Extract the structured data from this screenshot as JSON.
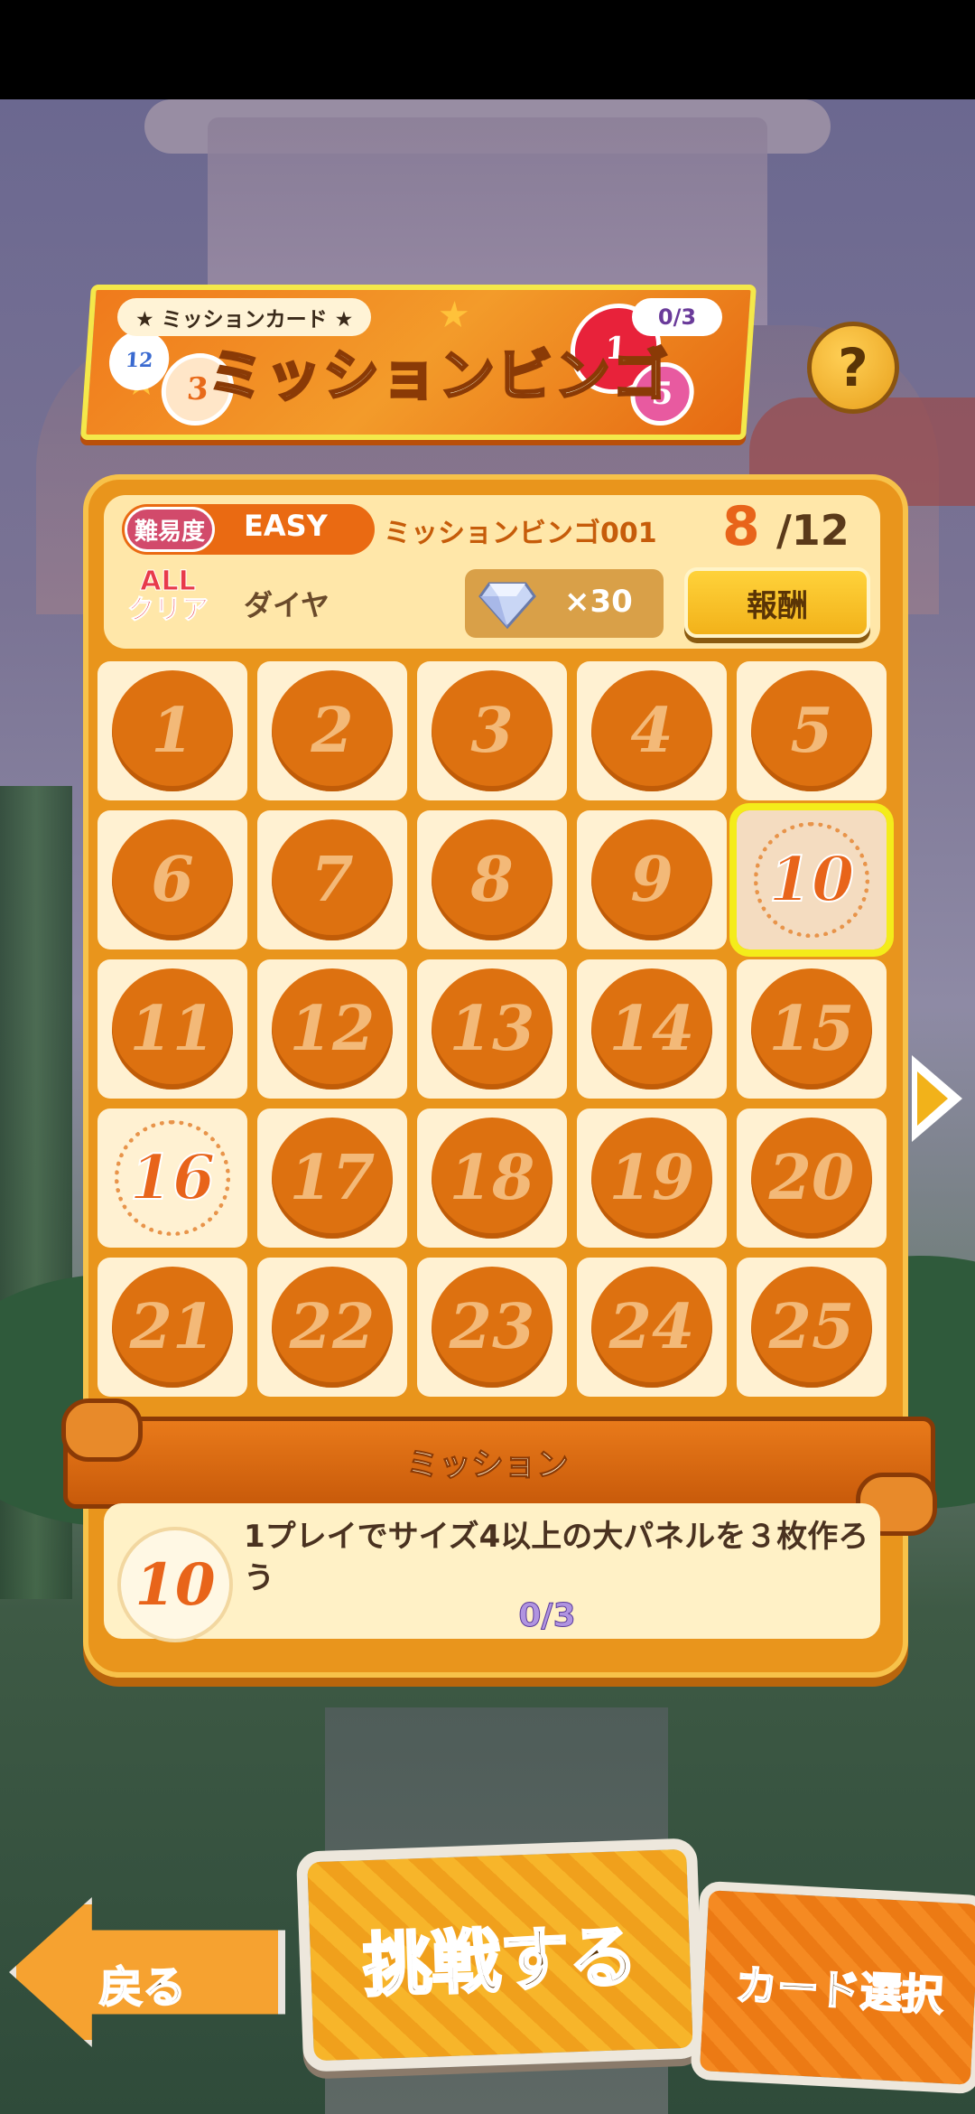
{
  "header": {
    "subtitle": "★ ミッションカード ★",
    "title": "ミッションビンゴ",
    "card_count": "0/3",
    "help_label": "?"
  },
  "card": {
    "difficulty_label": "難易度",
    "difficulty_value": "EASY",
    "name": "ミッションビンゴ001",
    "progress_current": "8",
    "progress_total": "/12",
    "allclear_label": "ALL\nクリア",
    "reward_name": "ダイヤ",
    "reward_qty": "×30",
    "reward_button": "報酬"
  },
  "grid": {
    "cells": [
      "1",
      "2",
      "3",
      "4",
      "5",
      "6",
      "7",
      "8",
      "9",
      "10",
      "11",
      "12",
      "13",
      "14",
      "15",
      "16",
      "17",
      "18",
      "19",
      "20",
      "21",
      "22",
      "23",
      "24",
      "25"
    ],
    "open_cells": [
      "10",
      "16"
    ],
    "selected_cell": "10"
  },
  "mission": {
    "ribbon_title": "ミッション",
    "number": "10",
    "text": "1プレイでサイズ4以上の大パネルを３枚作ろう",
    "progress": "0/3"
  },
  "buttons": {
    "back": "戻る",
    "challenge": "挑戦する",
    "card_select": "カード選択"
  },
  "colors": {
    "panel": "#e9951c",
    "highlight": "#f4ec1a",
    "accent": "#e8641a"
  }
}
